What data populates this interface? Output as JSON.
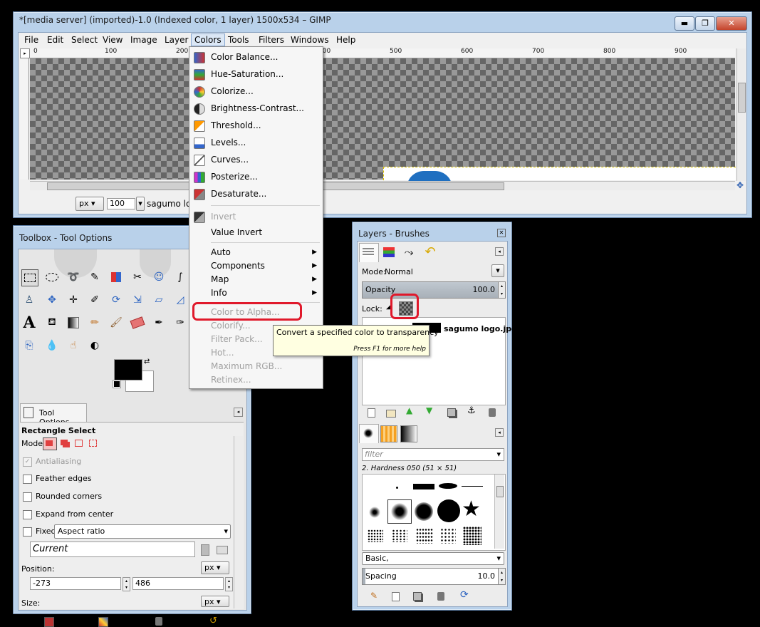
{
  "main_window": {
    "title": "*[media server] (imported)-1.0 (Indexed color, 1 layer) 1500x534 – GIMP",
    "controls": {
      "minimize": "▬",
      "maximize": "❐",
      "close": "✕"
    },
    "menus": [
      "File",
      "Edit",
      "Select",
      "View",
      "Image",
      "Layer",
      "Colors",
      "Tools",
      "Filters",
      "Windows",
      "Help"
    ],
    "ruler_labels": [
      "0",
      "100",
      "200",
      "300",
      "400",
      "500",
      "600",
      "700",
      "800",
      "900"
    ],
    "status": {
      "unit": "px",
      "zoom": "100",
      "layer_name": "sagumo logo"
    }
  },
  "colors_menu": {
    "group1": [
      "Color Balance...",
      "Hue-Saturation...",
      "Colorize...",
      "Brightness-Contrast...",
      "Threshold...",
      "Levels...",
      "Curves...",
      "Posterize...",
      "Desaturate..."
    ],
    "group2": [
      "Invert",
      "Value Invert"
    ],
    "submenus": [
      "Auto",
      "Components",
      "Map",
      "Info"
    ],
    "group3": [
      "Color to Alpha...",
      "Colorify...",
      "Filter Pack...",
      "Hot...",
      "Maximum RGB...",
      "Retinex..."
    ]
  },
  "tooltip": {
    "text": "Convert a specified color to transparency",
    "hint": "Press F1 for more help"
  },
  "toolbox": {
    "title": "Toolbox - Tool Options",
    "tab": "Tool Options",
    "tool_name": "Rectangle Select",
    "mode_label": "Mode:",
    "options": [
      "Antialiasing",
      "Feather edges",
      "Rounded corners",
      "Expand from center"
    ],
    "fixed_label": "Fixed:",
    "fixed_value": "Aspect ratio",
    "current_value": "Current",
    "position_label": "Position:",
    "position_unit": "px",
    "position_x": "-273",
    "position_y": "486",
    "size_label": "Size:",
    "size_unit": "px"
  },
  "layers": {
    "title": "Layers - Brushes",
    "mode_label": "Mode:",
    "mode_value": "Normal",
    "opacity_label": "Opacity",
    "opacity_value": "100.0",
    "lock_label": "Lock:",
    "layer_name": "sagumo logo.jpg",
    "filter_placeholder": "filter",
    "brush_name": "2. Hardness 050 (51 × 51)",
    "brush_set": "Basic,",
    "spacing_label": "Spacing",
    "spacing_value": "10.0"
  }
}
